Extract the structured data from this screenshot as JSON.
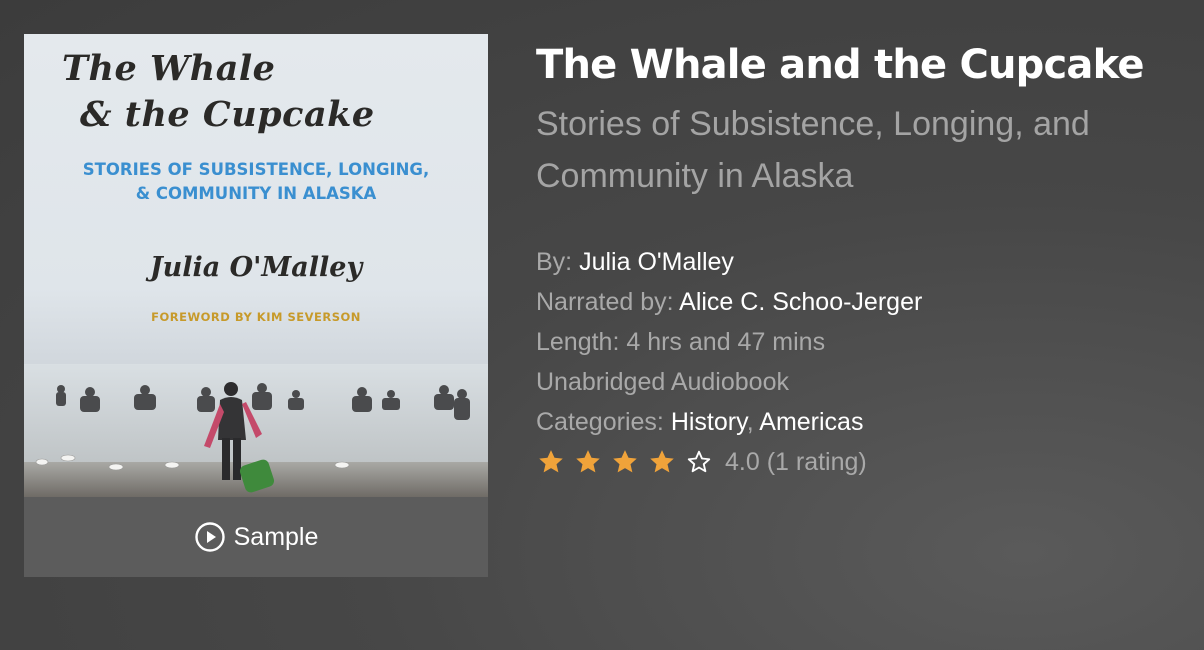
{
  "cover": {
    "title_line1": "The Whale",
    "title_line2": "& the Cupcake",
    "subtitle_line1": "STORIES OF SUBSISTENCE, LONGING,",
    "subtitle_line2": "& COMMUNITY IN ALASKA",
    "author": "Julia O'Malley",
    "foreword": "FOREWORD BY KIM SEVERSON"
  },
  "sample": {
    "label": "Sample"
  },
  "book": {
    "title": "The Whale and the Cupcake",
    "subtitle": "Stories of Subsistence, Longing, and Community in Alaska",
    "by_label": "By:",
    "author": "Julia O'Malley",
    "narrated_label": "Narrated by:",
    "narrator": "Alice C. Schoo-Jerger",
    "length": "Length: 4 hrs and 47 mins",
    "format": "Unabridged Audiobook",
    "categories_label": "Categories:",
    "categories": [
      "History",
      "Americas"
    ],
    "category_separator": ", ",
    "rating": {
      "value": 4,
      "max": 5,
      "text": "4.0 (1 rating)"
    }
  },
  "colors": {
    "star_filled": "#f0a33a",
    "accent_blue": "#3a8fd0",
    "foreword_gold": "#c79a2a"
  }
}
